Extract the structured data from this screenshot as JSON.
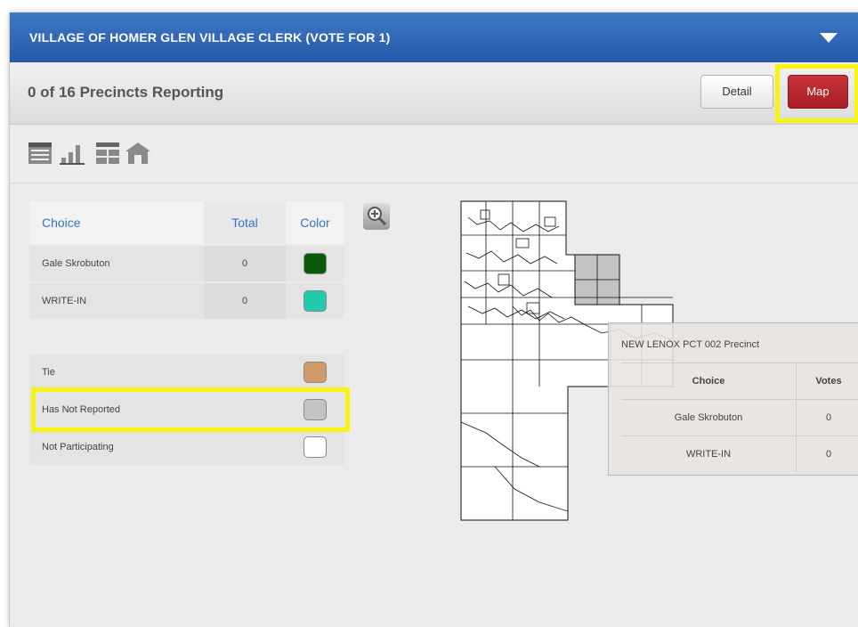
{
  "race": {
    "title": "VILLAGE OF HOMER GLEN VILLAGE CLERK (VOTE FOR 1)",
    "collapse_icon": "chevron-down-icon"
  },
  "reporting": {
    "text": "0 of 16 Precincts Reporting",
    "detail_label": "Detail",
    "map_label": "Map"
  },
  "view_icons": [
    "table-view-icon",
    "bar-chart-icon",
    "grid-view-icon",
    "home-icon"
  ],
  "legend": {
    "headers": {
      "choice": "Choice",
      "total": "Total",
      "color": "Color"
    },
    "rows": [
      {
        "name": "Gale Skrobuton",
        "total": "0",
        "color": "#0a5a0a"
      },
      {
        "name": "WRITE-IN",
        "total": "0",
        "color": "#22ccaa"
      }
    ]
  },
  "status": [
    {
      "name": "Tie",
      "color": "#d09a6a"
    },
    {
      "name": "Has Not Reported",
      "color": "#c3c3c3"
    },
    {
      "name": "Not Participating",
      "color": "#ffffff"
    }
  ],
  "zoom_icon": "zoom-in-icon",
  "tooltip": {
    "title": "NEW LENOX PCT 002 Precinct",
    "headers": {
      "choice": "Choice",
      "votes": "Votes"
    },
    "rows": [
      {
        "choice": "Gale Skrobuton",
        "votes": "0"
      },
      {
        "choice": "WRITE-IN",
        "votes": "0"
      }
    ]
  }
}
